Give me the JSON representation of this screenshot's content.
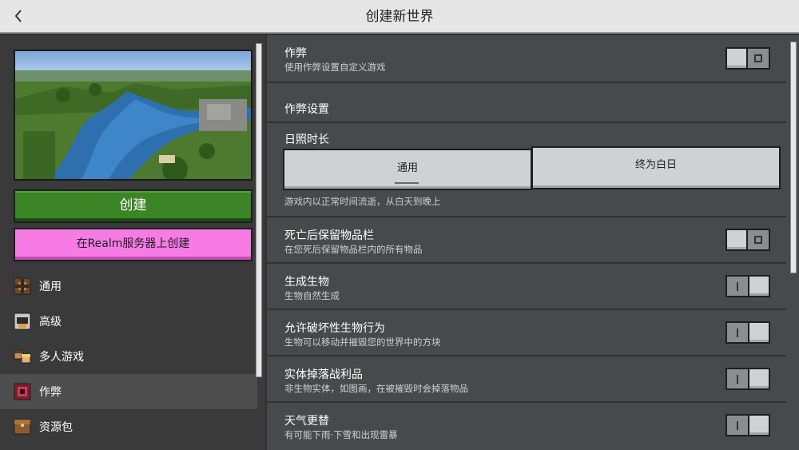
{
  "header": {
    "title": "创建新世界",
    "back_icon": "chevron-left-icon"
  },
  "left": {
    "create_label": "创建",
    "realm_label": "在Realm服务器上创建",
    "nav": [
      {
        "label": "通用",
        "icon": "settings-block-icon",
        "active": false
      },
      {
        "label": "高级",
        "icon": "advanced-icon",
        "active": false
      },
      {
        "label": "多人游戏",
        "icon": "multiplayer-icon",
        "active": false
      },
      {
        "label": "作弊",
        "icon": "cheats-icon",
        "active": true
      },
      {
        "label": "资源包",
        "icon": "resource-pack-icon",
        "active": false
      }
    ]
  },
  "right": {
    "cheats": {
      "title": "作弊",
      "desc": "使用作弊设置自定义游戏",
      "state": "off"
    },
    "cheat_settings_label": "作弊设置",
    "daylight": {
      "title": "日照时长",
      "options": [
        "通用",
        "终为白日"
      ],
      "selected": "通用",
      "desc": "游戏内以正常时间流逝，从白天到晚上"
    },
    "toggles": [
      {
        "title": "死亡后保留物品栏",
        "desc": "在您死后保留物品栏内的所有物品",
        "state": "off"
      },
      {
        "title": "生成生物",
        "desc": "生物自然生成",
        "state": "on"
      },
      {
        "title": "允许破坏性生物行为",
        "desc": "生物可以移动并摧毁您的世界中的方块",
        "state": "on"
      },
      {
        "title": "实体掉落战利品",
        "desc": "非生物实体，如图画，在被摧毁时会掉落物品",
        "state": "on"
      },
      {
        "title": "天气更替",
        "desc": "有可能下雨·下雪和出现雷暴",
        "state": "on"
      }
    ]
  }
}
